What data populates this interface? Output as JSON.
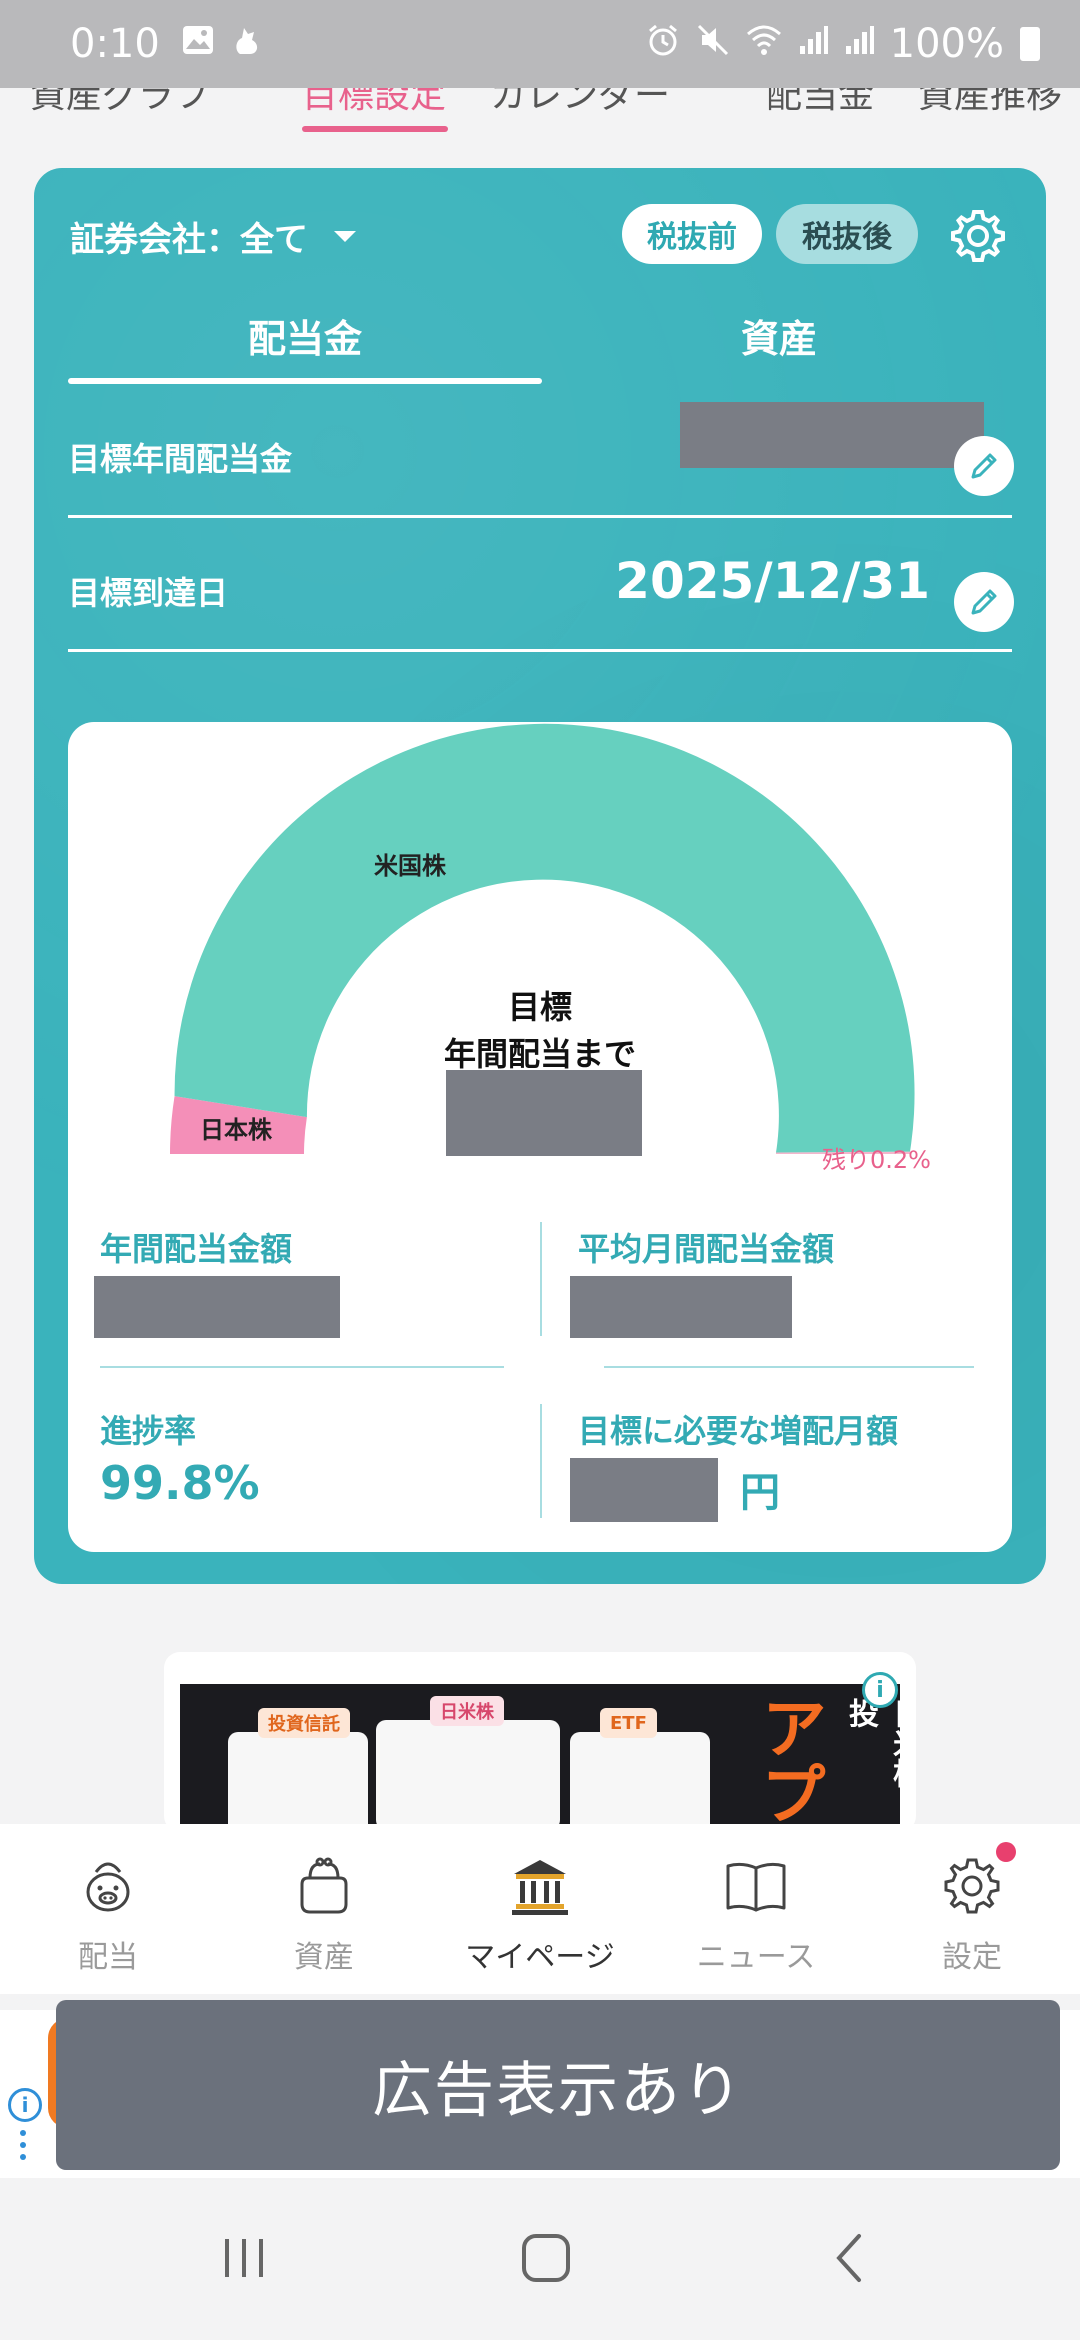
{
  "status_bar": {
    "time": "0:10",
    "battery": "100%"
  },
  "top_tabs": [
    {
      "label": "資産グラフ"
    },
    {
      "label": "目標設定"
    },
    {
      "label": "カレンダー"
    },
    {
      "label": "配当金"
    },
    {
      "label": "資産推移"
    }
  ],
  "card": {
    "broker_label": "証券会社：全て",
    "tax_before": "税抜前",
    "tax_after": "税抜後",
    "subtabs": [
      {
        "label": "配当金",
        "active": true
      },
      {
        "label": "資産",
        "active": false
      }
    ],
    "target_annual_label": "目標年間配当金",
    "target_date_label": "目標到達日",
    "target_date_value": "2025/12/31"
  },
  "gauge": {
    "labels": {
      "us": "米国株",
      "jp": "日本株",
      "remain": "残り0.2%"
    },
    "center_line1": "目標",
    "center_line2": "年間配当まで",
    "progress_fraction": 0.998,
    "segments": [
      {
        "name": "米国株",
        "fraction": 0.948,
        "color": "#66d0bf"
      },
      {
        "name": "日本株",
        "fraction": 0.05,
        "color": "#f48fb8"
      }
    ]
  },
  "stats": {
    "annual_label": "年間配当金額",
    "monthly_label": "平均月間配当金額",
    "progress_label": "進捗率",
    "progress_value": "99.8%",
    "needed_label": "目標に必要な増配月額",
    "needed_suffix": "円"
  },
  "ad_card": {
    "tags": [
      "投資信託",
      "日米株",
      "ETF"
    ],
    "big_text": "アプ",
    "right_text": "日米株・投"
  },
  "bottom_nav": [
    {
      "label": "配当",
      "icon": "piggy-bank-icon"
    },
    {
      "label": "資産",
      "icon": "purse-icon"
    },
    {
      "label": "マイページ",
      "icon": "bank-building-icon",
      "active": true
    },
    {
      "label": "ニュース",
      "icon": "open-book-icon"
    },
    {
      "label": "設定",
      "icon": "gear-icon"
    }
  ],
  "ad_overlay": {
    "text": "広告表示あり"
  },
  "colors": {
    "teal": "#3ab3bc",
    "pink": "#e8618c",
    "mint": "#66d0bf"
  }
}
